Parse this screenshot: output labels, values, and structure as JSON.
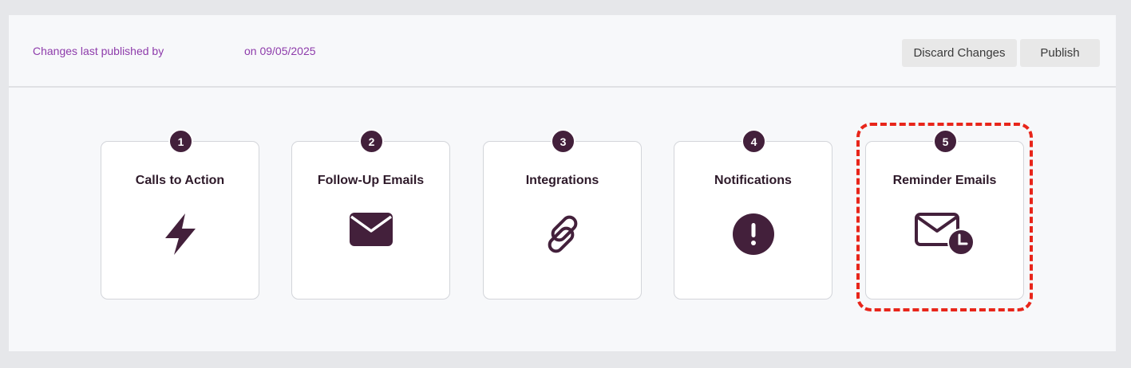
{
  "header": {
    "published_prefix": "Changes last published by",
    "published_date": "on 09/05/2025",
    "discard_label": "Discard Changes",
    "publish_label": "Publish"
  },
  "steps": [
    {
      "number": "1",
      "title": "Calls to Action",
      "icon": "lightning-bolt-icon"
    },
    {
      "number": "2",
      "title": "Follow-Up Emails",
      "icon": "envelope-icon"
    },
    {
      "number": "3",
      "title": "Integrations",
      "icon": "link-icon"
    },
    {
      "number": "4",
      "title": "Notifications",
      "icon": "alert-circle-icon"
    },
    {
      "number": "5",
      "title": "Reminder Emails",
      "icon": "envelope-clock-icon"
    }
  ],
  "highlighted_step": "5",
  "colors": {
    "accent_text": "#8e3cab",
    "icon_color": "#43203b",
    "highlight_border": "#e8251a",
    "page_background": "#e6e7ea",
    "panel_background": "#f7f8fa"
  }
}
